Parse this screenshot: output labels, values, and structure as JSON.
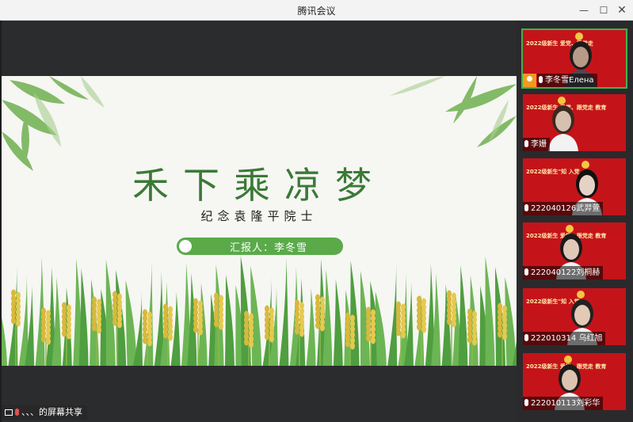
{
  "window": {
    "title": "腾讯会议",
    "controls": {
      "minimize": "—",
      "maximize": "☐",
      "close": "✕"
    }
  },
  "slide": {
    "title": "禾下乘凉梦",
    "subtitle": "纪念袁隆平院士",
    "reporter": "汇报人：李冬雪"
  },
  "share": {
    "label": "、、、的屏幕共享"
  },
  "participants": [
    {
      "name": "李冬雪Елена",
      "banner": "2022级新生 爱党、跟党走",
      "host": true,
      "active": true
    },
    {
      "name": "李姗",
      "banner": "2022级新生 爱党、跟党走 教育",
      "host": false,
      "active": false
    },
    {
      "name": "222040126武羿萱",
      "banner": "2022级新生\"知 入党",
      "host": false,
      "active": false
    },
    {
      "name": "222040122刘桐赫",
      "banner": "2022级新生 爱党、跟党走 教育",
      "host": false,
      "active": false
    },
    {
      "name": "222010314 乌红旭",
      "banner": "2022级新生\"知 入党",
      "host": false,
      "active": false
    },
    {
      "name": "222010113刘彩华",
      "banner": "2022级新生 爱党、跟党走 教育",
      "host": false,
      "active": false
    }
  ],
  "colors": {
    "slide_green": "#3a7a36",
    "pill_green": "#5aaa4a",
    "tile_red": "#c4141a",
    "active_border": "#3fb34f",
    "host_orange": "#f29a1d"
  }
}
